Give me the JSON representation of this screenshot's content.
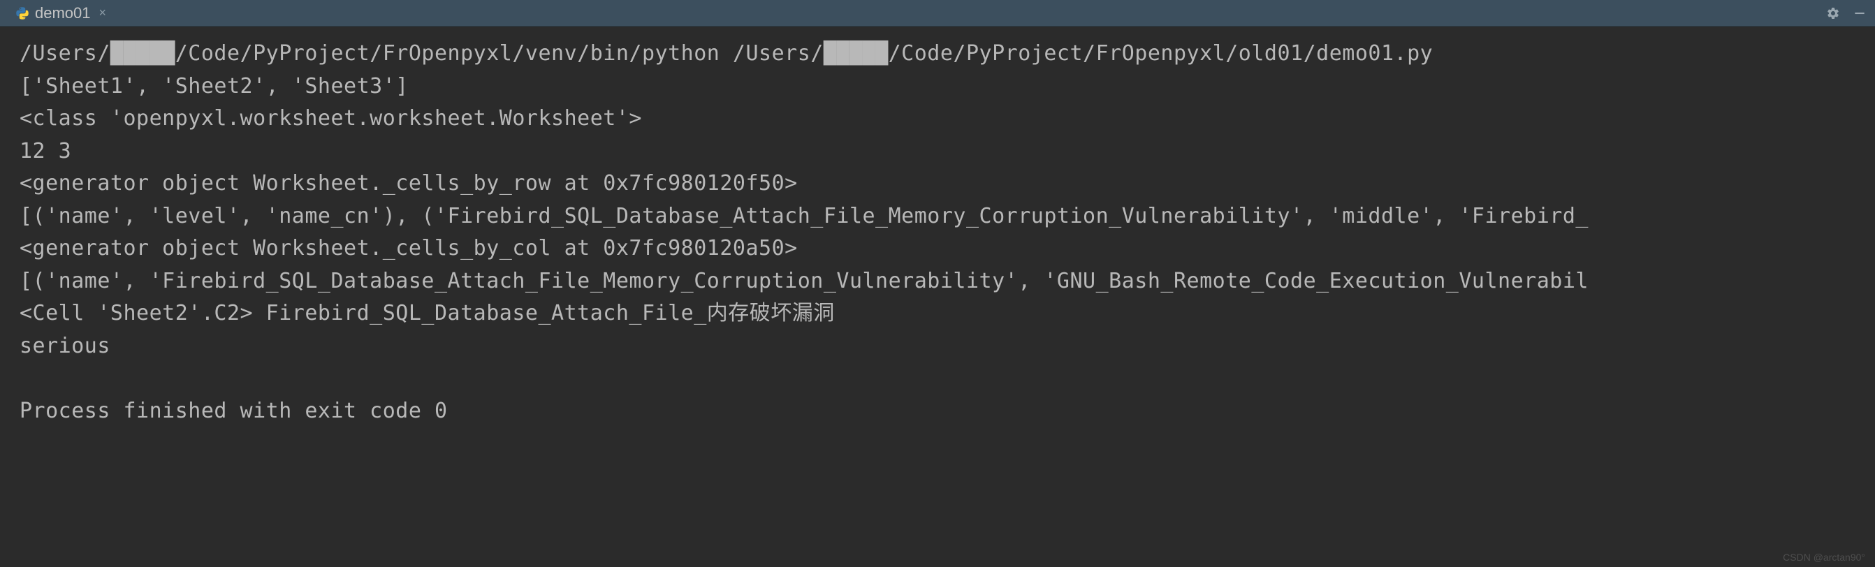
{
  "header": {
    "tab": {
      "icon": "python-icon",
      "label": "demo01",
      "close_icon": "close-icon"
    },
    "controls": {
      "gear_icon": "gear-icon",
      "minimize_icon": "minimize-icon"
    }
  },
  "console": {
    "lines": [
      "/Users/█████/Code/PyProject/FrOpenpyxl/venv/bin/python /Users/█████/Code/PyProject/FrOpenpyxl/old01/demo01.py",
      "['Sheet1', 'Sheet2', 'Sheet3']",
      "<class 'openpyxl.worksheet.worksheet.Worksheet'>",
      "12 3",
      "<generator object Worksheet._cells_by_row at 0x7fc980120f50>",
      "[('name', 'level', 'name_cn'), ('Firebird_SQL_Database_Attach_File_Memory_Corruption_Vulnerability', 'middle', 'Firebird_",
      "<generator object Worksheet._cells_by_col at 0x7fc980120a50>",
      "[('name', 'Firebird_SQL_Database_Attach_File_Memory_Corruption_Vulnerability', 'GNU_Bash_Remote_Code_Execution_Vulnerabil",
      "<Cell 'Sheet2'.C2> Firebird_SQL_Database_Attach_File_内存破坏漏洞",
      "serious",
      "",
      "Process finished with exit code 0"
    ]
  },
  "watermark": "CSDN @arctan90°"
}
